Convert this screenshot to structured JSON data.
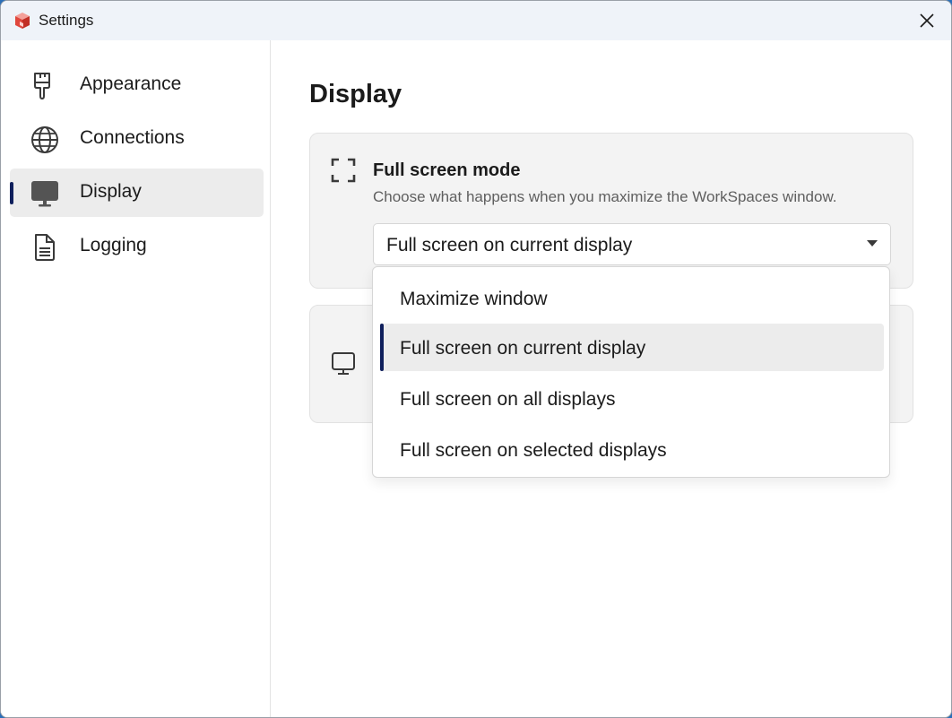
{
  "window": {
    "title": "Settings",
    "close_icon": "close-icon",
    "app_icon": "workspaces-cube-icon"
  },
  "sidebar": {
    "items": [
      {
        "label": "Appearance",
        "icon": "paintbrush-icon",
        "active": false
      },
      {
        "label": "Connections",
        "icon": "globe-icon",
        "active": false
      },
      {
        "label": "Display",
        "icon": "monitor-icon",
        "active": true
      },
      {
        "label": "Logging",
        "icon": "document-icon",
        "active": false
      }
    ]
  },
  "main": {
    "title": "Display",
    "fullscreen_card": {
      "icon": "fullscreen-icon",
      "title": "Full screen mode",
      "description": "Choose what happens when you maximize the WorkSpaces window.",
      "select_value": "Full screen on current display"
    },
    "second_card": {
      "icon": "monitor-outline-icon"
    }
  },
  "dropdown": {
    "options": [
      {
        "label": "Maximize window",
        "selected": false
      },
      {
        "label": "Full screen on current display",
        "selected": true
      },
      {
        "label": "Full screen on all displays",
        "selected": false
      },
      {
        "label": "Full screen on selected displays",
        "selected": false
      }
    ]
  },
  "colors": {
    "accent": "#0f1f5c",
    "titlebar": "#eff3f9",
    "card": "#f3f3f3",
    "selected": "#ececec"
  }
}
